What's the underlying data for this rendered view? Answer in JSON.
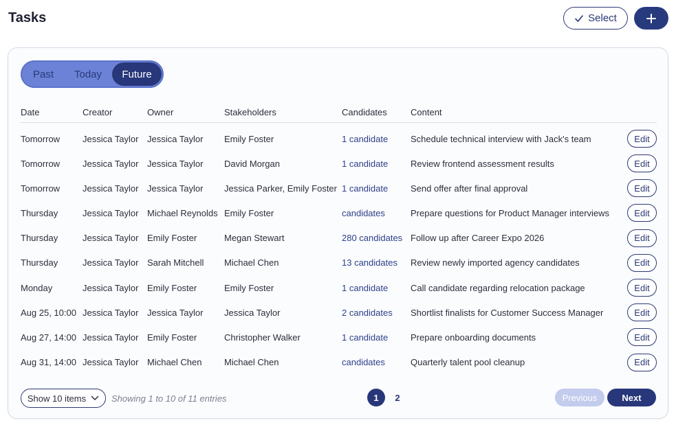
{
  "header": {
    "title": "Tasks",
    "select_label": "Select",
    "select_icon": "check-icon",
    "add_icon": "plus-icon"
  },
  "tabs": {
    "items": [
      "Past",
      "Today",
      "Future"
    ],
    "active": "Future"
  },
  "table": {
    "columns": [
      "Date",
      "Creator",
      "Owner",
      "Stakeholders",
      "Candidates",
      "Content"
    ],
    "edit_label": "Edit",
    "rows": [
      {
        "date": "Tomorrow",
        "creator": "Jessica Taylor",
        "owner": "Jessica Taylor",
        "stakeholders": "Emily Foster",
        "candidates": "1 candidate",
        "content": "Schedule technical interview with Jack's team"
      },
      {
        "date": "Tomorrow",
        "creator": "Jessica Taylor",
        "owner": "Jessica Taylor",
        "stakeholders": "David Morgan",
        "candidates": "1 candidate",
        "content": "Review frontend assessment results"
      },
      {
        "date": "Tomorrow",
        "creator": "Jessica Taylor",
        "owner": "Jessica Taylor",
        "stakeholders": "Jessica Parker, Emily Foster",
        "candidates": "1 candidate",
        "content": "Send offer after final approval"
      },
      {
        "date": "Thursday",
        "creator": "Jessica Taylor",
        "owner": "Michael Reynolds",
        "stakeholders": "Emily Foster",
        "candidates": "candidates",
        "content": "Prepare questions for Product Manager interviews"
      },
      {
        "date": "Thursday",
        "creator": "Jessica Taylor",
        "owner": "Emily Foster",
        "stakeholders": "Megan Stewart",
        "candidates": "280 candidates",
        "content": "Follow up after Career Expo 2026"
      },
      {
        "date": "Thursday",
        "creator": "Jessica Taylor",
        "owner": "Sarah Mitchell",
        "stakeholders": "Michael Chen",
        "candidates": "13 candidates",
        "content": "Review newly imported agency candidates"
      },
      {
        "date": "Monday",
        "creator": "Jessica Taylor",
        "owner": "Emily Foster",
        "stakeholders": "Emily Foster",
        "candidates": "1 candidate",
        "content": "Call candidate regarding relocation package"
      },
      {
        "date": "Aug 25, 10:00",
        "creator": "Jessica Taylor",
        "owner": "Jessica Taylor",
        "stakeholders": "Jessica Taylor",
        "candidates": "2 candidates",
        "content": "Shortlist finalists for Customer Success Manager"
      },
      {
        "date": "Aug 27, 14:00",
        "creator": "Jessica Taylor",
        "owner": "Emily Foster",
        "stakeholders": "Christopher Walker",
        "candidates": "1 candidate",
        "content": "Prepare onboarding documents"
      },
      {
        "date": "Aug 31, 14:00",
        "creator": "Jessica Taylor",
        "owner": "Michael Chen",
        "stakeholders": "Michael Chen",
        "candidates": "candidates",
        "content": "Quarterly talent pool cleanup"
      }
    ]
  },
  "footer": {
    "show_label": "Show 10 items",
    "show_icon": "chevron-down-icon",
    "showing_text": "Showing 1 to 10 of 11 entries",
    "pages": [
      "1",
      "2"
    ],
    "current_page": "1",
    "previous_label": "Previous",
    "next_label": "Next"
  },
  "colors": {
    "primary": "#27377a",
    "segment_bg": "#6b82d6",
    "previous_disabled": "#c3cced"
  }
}
